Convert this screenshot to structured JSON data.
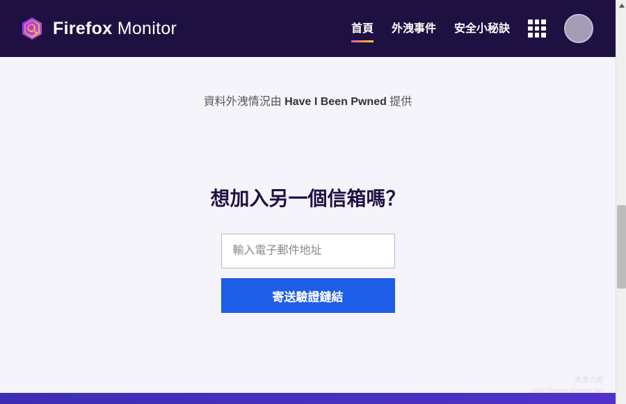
{
  "header": {
    "logo_bold": "Firefox",
    "logo_light": " Monitor",
    "nav": {
      "home": "首頁",
      "breaches": "外洩事件",
      "tips": "安全小秘訣"
    }
  },
  "attribution": {
    "prefix": "資料外洩情況由 ",
    "source": "Have I Been Pwned",
    "suffix": " 提供"
  },
  "form": {
    "heading": "想加入另一個信箱嗎？",
    "placeholder": "輸入電子郵件地址",
    "submit": "寄送驗證鏈結"
  },
  "watermark": {
    "line1": "清渡の窩",
    "line2": "http://www.vixyao.tw/"
  }
}
